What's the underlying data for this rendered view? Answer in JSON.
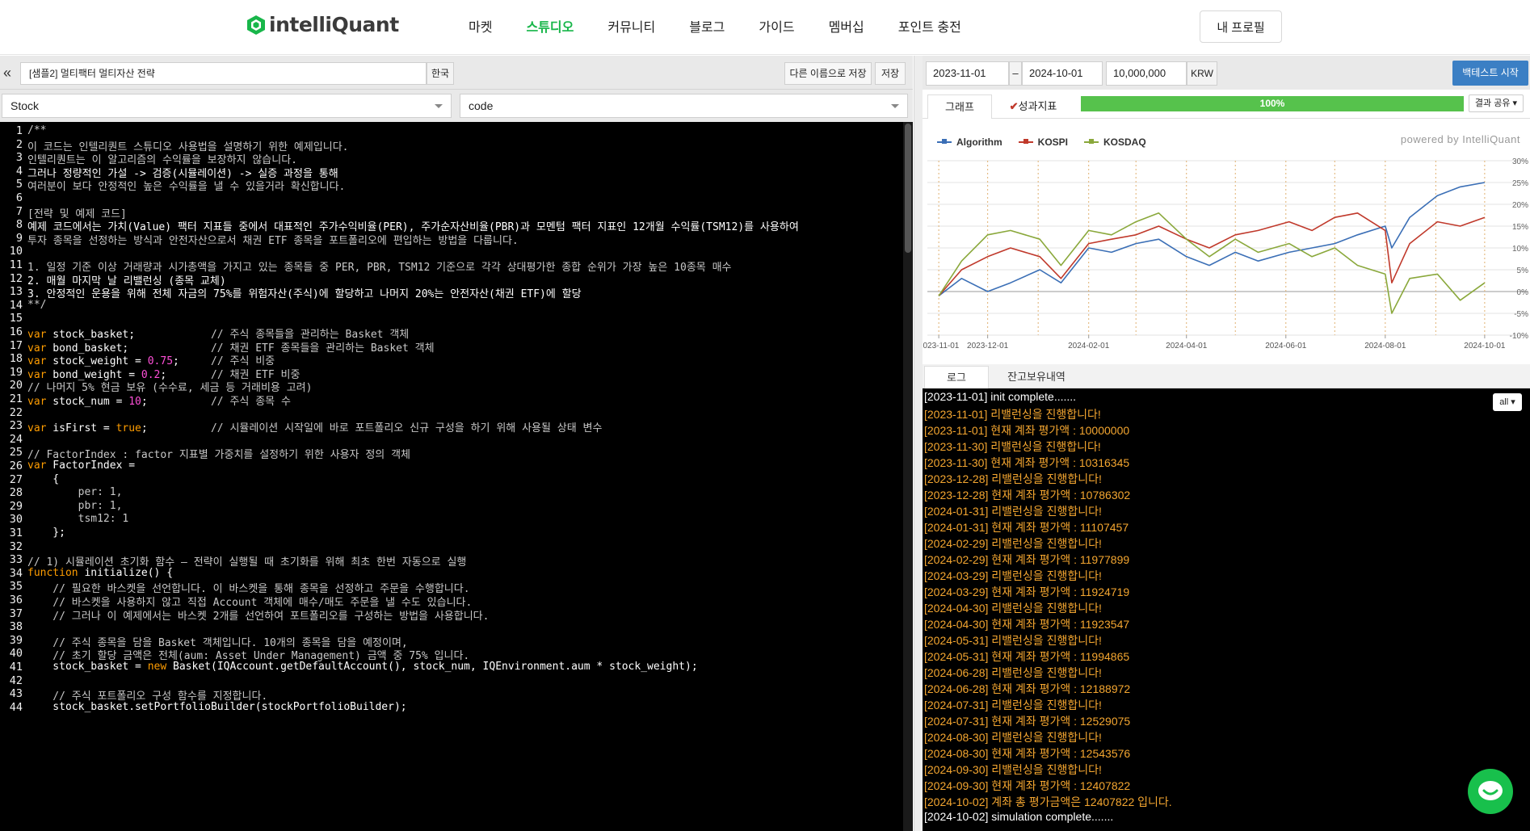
{
  "nav": {
    "logo_text": "intelliQuant",
    "menu": [
      "마켓",
      "스튜디오",
      "커뮤니티",
      "블로그",
      "가이드",
      "멤버십",
      "포인트 충전"
    ],
    "active_menu": "스튜디오",
    "profile_label": "내 프로필",
    "brand_color": "#18b64a"
  },
  "editor": {
    "collapse_icon": "double-chevron-left-icon",
    "strategy_title": "[샘플2] 멀티팩터 멀티자산 전략",
    "lang_label": "한국",
    "save_as_label": "다른 이름으로 저장",
    "save_label": "저장",
    "type_select": "Stock",
    "view_select": "code",
    "code_lines": [
      "/**",
      "이 코드는 인텔리퀀트 스튜디오 사용법을 설명하기 위한 예제입니다.",
      "인텔리퀀트는 이 알고리즘의 수익률을 보장하지 않습니다.",
      "그러나 정량적인 가설 -> 검증(시뮬레이션) -> 실증 과정을 통해",
      "여러분이 보다 안정적인 높은 수익률을 낼 수 있을거라 확신합니다.",
      "",
      "[전략 및 예제 코드]",
      "예제 코드에서는 가치(Value) 팩터 지표들 중에서 대표적인 주가수익비율(PER), 주가순자산비율(PBR)과 모멘텀 팩터 지표인 12개월 수익률(TSM12)를 사용하여",
      "투자 종목을 선정하는 방식과 안전자산으로서 채권 ETF 종목을 포트폴리오에 편입하는 방법을 다룹니다.",
      "",
      "1. 일정 기준 이상 거래량과 시가총액을 가지고 있는 종목들 중 PER, PBR, TSM12 기준으로 각각 상대평가한 종합 순위가 가장 높은 10종목 매수",
      "2. 매월 마지막 날 리밸런싱 (종목 교체)",
      "3. 안정적인 운용을 위해 전체 자금의 75%를 위험자산(주식)에 할당하고 나머지 20%는 안전자산(채권 ETF)에 할당",
      "**/",
      "",
      "var stock_basket;            // 주식 종목들을 관리하는 Basket 객체",
      "var bond_basket;             // 채권 ETF 종목들을 관리하는 Basket 객체",
      "var stock_weight = 0.75;     // 주식 비중",
      "var bond_weight = 0.2;       // 채권 ETF 비중",
      "// 나머지 5% 현금 보유 (수수료, 세금 등 거래비용 고려)",
      "var stock_num = 10;          // 주식 종목 수",
      "",
      "var isFirst = true;          // 시뮬레이션 시작일에 바로 포트폴리오 신규 구성을 하기 위해 사용될 상태 변수",
      "",
      "// FactorIndex : factor 지표별 가중치를 설정하기 위한 사용자 정의 객체",
      "var FactorIndex =",
      "    {",
      "        per: 1,",
      "        pbr: 1,",
      "        tsm12: 1",
      "    };",
      "",
      "// 1) 시뮬레이션 초기화 함수 – 전략이 실행될 때 초기화를 위해 최초 한번 자동으로 실행",
      "function initialize() {",
      "    // 필요한 바스켓을 선언합니다. 이 바스켓을 통해 종목을 선정하고 주문을 수행합니다.",
      "    // 바스켓을 사용하지 않고 직접 Account 객체에 매수/매도 주문을 낼 수도 있습니다.",
      "    // 그러나 이 예제에서는 바스켓 2개를 선언하여 포트폴리오를 구성하는 방법을 사용합니다.",
      "",
      "    // 주식 종목을 담을 Basket 객체입니다. 10개의 종목을 담을 예정이며,",
      "    // 초기 할당 금액은 전체(aum: Asset Under Management) 금액 중 75% 입니다.",
      "    stock_basket = new Basket(IQAccount.getDefaultAccount(), stock_num, IQEnvironment.aum * stock_weight);",
      "",
      "    // 주식 포트폴리오 구성 함수를 지정합니다.",
      "    stock_basket.setPortfolioBuilder(stockPortfolioBuilder);"
    ]
  },
  "backtest": {
    "start_date": "2023-11-01",
    "dash": "–",
    "end_date": "2024-10-01",
    "capital": "10,000,000",
    "currency": "KRW",
    "run_label": "백테스트 시작",
    "tab_graph": "그래프",
    "tab_metrics": "성과지표",
    "progress_text": "100%",
    "progress_value": 1.0,
    "share_label": "결과 공유",
    "powered_by": "powered by IntelliQuant",
    "log_tab": "로그",
    "holdings_tab": "잔고보유내역",
    "filter_label": "all"
  },
  "chart_data": {
    "type": "line",
    "title": "",
    "xlabel": "",
    "ylabel": "",
    "ylim": [
      -10,
      30
    ],
    "y_ticks": [
      "30%",
      "25%",
      "20%",
      "15%",
      "10%",
      "5%",
      "0%",
      "-5%",
      "-10%"
    ],
    "x_tick_labels": [
      "2023-11-01",
      "2023-12-01",
      "2024-02-01",
      "2024-04-01",
      "2024-06-01",
      "2024-08-01",
      "2024-10-01"
    ],
    "legend_position": "top-left",
    "grid": true,
    "x": [
      "2023-11-01",
      "2023-11-15",
      "2023-12-01",
      "2023-12-15",
      "2024-01-02",
      "2024-01-15",
      "2024-02-01",
      "2024-02-15",
      "2024-03-01",
      "2024-03-15",
      "2024-04-01",
      "2024-04-15",
      "2024-05-01",
      "2024-05-15",
      "2024-06-03",
      "2024-06-17",
      "2024-07-01",
      "2024-07-15",
      "2024-08-01",
      "2024-08-05",
      "2024-08-16",
      "2024-09-02",
      "2024-09-16",
      "2024-10-01"
    ],
    "series": [
      {
        "name": "Algorithm",
        "color": "#3b6fb6",
        "values": [
          -1,
          3,
          0,
          2,
          5,
          2,
          10,
          9,
          11,
          12,
          8,
          6,
          9,
          7,
          9,
          10,
          11,
          13,
          15,
          10,
          17,
          22,
          24,
          25
        ]
      },
      {
        "name": "KOSPI",
        "color": "#c0392b",
        "values": [
          -1,
          5,
          8,
          10,
          8,
          3,
          11,
          12,
          13,
          15,
          12,
          10,
          13,
          14,
          16,
          14,
          17,
          18,
          14,
          2,
          11,
          16,
          15,
          17
        ]
      },
      {
        "name": "KOSDAQ",
        "color": "#8aa83b",
        "values": [
          -1,
          7,
          13,
          14,
          12,
          6,
          14,
          13,
          16,
          18,
          12,
          8,
          12,
          9,
          11,
          8,
          10,
          6,
          4,
          -5,
          3,
          4,
          -2,
          2
        ]
      }
    ]
  },
  "log_lines": [
    {
      "t": "[2023-11-01] init complete.......",
      "c": "white"
    },
    {
      "t": "[2023-11-01] 리밸런싱을 진행합니다!",
      "c": "orange"
    },
    {
      "t": "[2023-11-01] 현재 계좌 평가액 : 10000000",
      "c": "orange"
    },
    {
      "t": "[2023-11-30] 리밸런싱을 진행합니다!",
      "c": "orange"
    },
    {
      "t": "[2023-11-30] 현재 계좌 평가액 : 10316345",
      "c": "orange"
    },
    {
      "t": "[2023-12-28] 리밸런싱을 진행합니다!",
      "c": "orange"
    },
    {
      "t": "[2023-12-28] 현재 계좌 평가액 : 10786302",
      "c": "orange"
    },
    {
      "t": "[2024-01-31] 리밸런싱을 진행합니다!",
      "c": "orange"
    },
    {
      "t": "[2024-01-31] 현재 계좌 평가액 : 11107457",
      "c": "orange"
    },
    {
      "t": "[2024-02-29] 리밸런싱을 진행합니다!",
      "c": "orange"
    },
    {
      "t": "[2024-02-29] 현재 계좌 평가액 : 11977899",
      "c": "orange"
    },
    {
      "t": "[2024-03-29] 리밸런싱을 진행합니다!",
      "c": "orange"
    },
    {
      "t": "[2024-03-29] 현재 계좌 평가액 : 11924719",
      "c": "orange"
    },
    {
      "t": "[2024-04-30] 리밸런싱을 진행합니다!",
      "c": "orange"
    },
    {
      "t": "[2024-04-30] 현재 계좌 평가액 : 11923547",
      "c": "orange"
    },
    {
      "t": "[2024-05-31] 리밸런싱을 진행합니다!",
      "c": "orange"
    },
    {
      "t": "[2024-05-31] 현재 계좌 평가액 : 11994865",
      "c": "orange"
    },
    {
      "t": "[2024-06-28] 리밸런싱을 진행합니다!",
      "c": "orange"
    },
    {
      "t": "[2024-06-28] 현재 계좌 평가액 : 12188972",
      "c": "orange"
    },
    {
      "t": "[2024-07-31] 리밸런싱을 진행합니다!",
      "c": "orange"
    },
    {
      "t": "[2024-07-31] 현재 계좌 평가액 : 12529075",
      "c": "orange"
    },
    {
      "t": "[2024-08-30] 리밸런싱을 진행합니다!",
      "c": "orange"
    },
    {
      "t": "[2024-08-30] 현재 계좌 평가액 : 12543576",
      "c": "orange"
    },
    {
      "t": "[2024-09-30] 리밸런싱을 진행합니다!",
      "c": "orange"
    },
    {
      "t": "[2024-09-30] 현재 계좌 평가액 : 12407822",
      "c": "orange"
    },
    {
      "t": "[2024-10-02] 계좌 총 평가금액은 12407822 입니다.",
      "c": "orange"
    },
    {
      "t": "[2024-10-02] simulation complete.......",
      "c": "white"
    }
  ],
  "colors": {
    "brand_green": "#18b64a",
    "run_button": "#3b7fc4",
    "progress": "#56c24c",
    "log_orange": "#f4a630",
    "keyword": "#ff9d00",
    "number": "#ff4fd8"
  },
  "chat_icon": "chat-bubble-icon"
}
